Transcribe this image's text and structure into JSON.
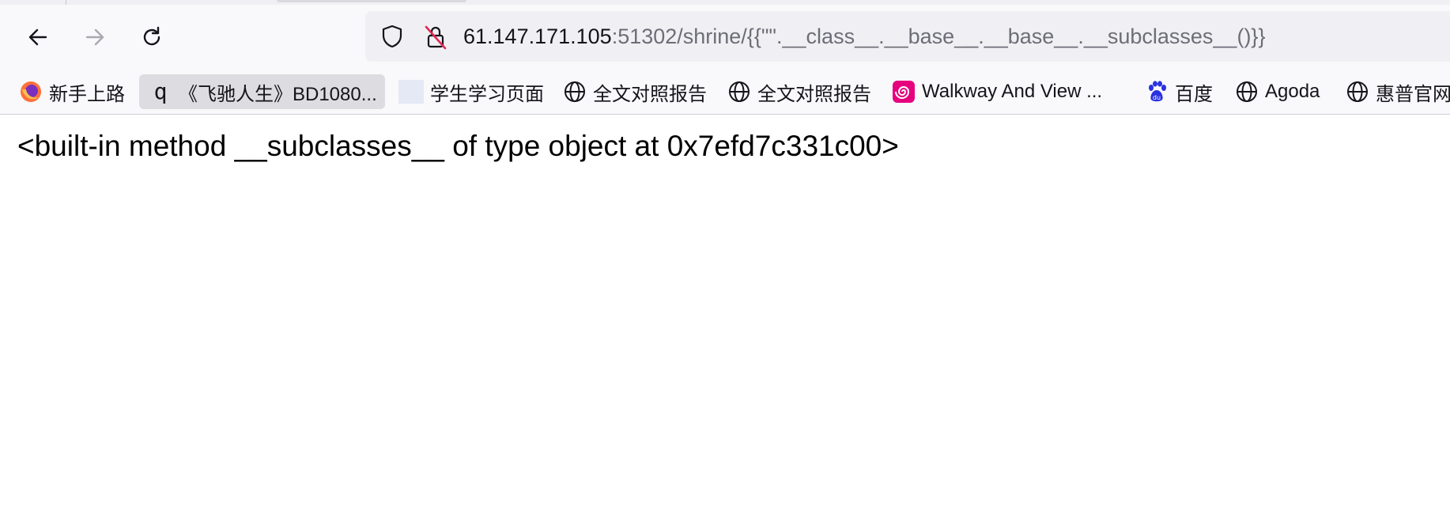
{
  "toolbar": {
    "back_icon": "back-arrow-icon",
    "forward_icon": "forward-arrow-icon",
    "reload_icon": "reload-icon"
  },
  "urlbar": {
    "host": "61.147.171.105",
    "rest": ":51302/shrine/{{\"\".__class__.__base__.__base__.__subclasses__()}}",
    "shield_icon": "shield-icon",
    "lock_icon": "insecure-lock-icon"
  },
  "bookmarks": [
    {
      "label": "新手上路",
      "icon": "firefox-icon"
    },
    {
      "label": "《飞驰人生》BD1080...",
      "icon": "q-icon"
    },
    {
      "label": "学生学习页面",
      "icon": "blank-page-icon"
    },
    {
      "label": "全文对照报告",
      "icon": "globe-icon"
    },
    {
      "label": "全文对照报告",
      "icon": "globe-icon"
    },
    {
      "label": "Walkway And View ...",
      "icon": "spiral-icon"
    },
    {
      "label": "百度",
      "icon": "baidu-paw-icon"
    },
    {
      "label": "Agoda",
      "icon": "globe-icon"
    },
    {
      "label": "惠普官网",
      "icon": "globe-icon"
    }
  ],
  "page": {
    "output_text": "<built-in method __subclasses__ of type object at 0x7efd7c331c00>"
  },
  "colors": {
    "toolbar_bg": "#f9f9fb",
    "urlbar_bg": "#f0f0f4",
    "url_dim": "#6d6d77",
    "baidu_blue": "#2932e1",
    "firefox_orange": "#ff7139"
  }
}
